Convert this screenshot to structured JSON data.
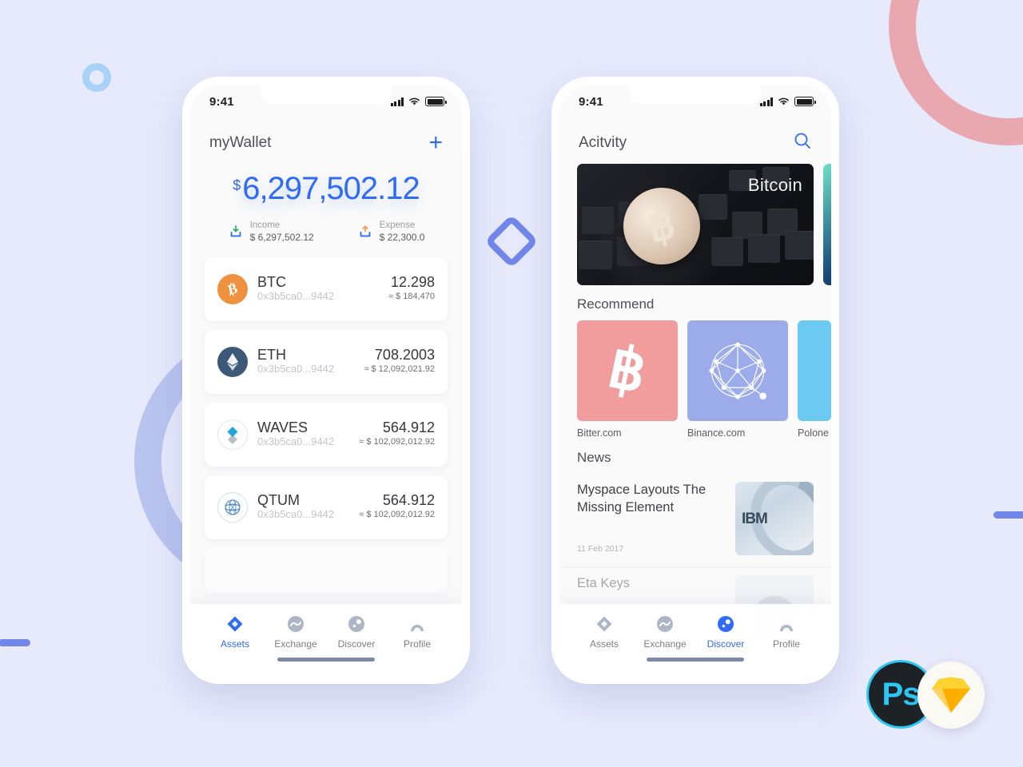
{
  "canvas": {
    "background": "#e7eafb",
    "accent": "#2f6bf5",
    "peri": "#7387ea",
    "pink": "#e9a7b0"
  },
  "badges": {
    "photoshop_label": "Ps",
    "sketch_label": "sketch-diamond-icon"
  },
  "phone1": {
    "status": {
      "time": "9:41",
      "signal": "signal-icon",
      "wifi": "wifi-icon",
      "battery": "battery-icon"
    },
    "header": {
      "title": "myWallet",
      "add_label": "+"
    },
    "balance": {
      "currency_symbol": "$",
      "amount": "6,297,502.12"
    },
    "summary": [
      {
        "label": "Income",
        "value": "$ 6,297,502.12",
        "icon": "income-icon"
      },
      {
        "label": "Expense",
        "value": "$ 22,300.0",
        "icon": "expense-icon"
      }
    ],
    "coins": [
      {
        "name": "BTC",
        "address": "0x3b5ca0...9442",
        "amount": "12.298",
        "usd": "≈ $ 184,470",
        "icon": "btc-icon"
      },
      {
        "name": "ETH",
        "address": "0x3b5ca0...9442",
        "amount": "708.2003",
        "usd": "≈ $ 12,092,021.92",
        "icon": "eth-icon"
      },
      {
        "name": "WAVES",
        "address": "0x3b5ca0...9442",
        "amount": "564.912",
        "usd": "≈ $ 102,092,012.92",
        "icon": "waves-icon"
      },
      {
        "name": "QTUM",
        "address": "0x3b5ca0...9442",
        "amount": "564.912",
        "usd": "≈ $ 102,092,012.92",
        "icon": "qtum-icon"
      }
    ],
    "tabs": [
      {
        "label": "Assets",
        "icon": "assets-icon",
        "active": true
      },
      {
        "label": "Exchange",
        "icon": "exchange-icon",
        "active": false
      },
      {
        "label": "Discover",
        "icon": "discover-icon",
        "active": false
      },
      {
        "label": "Profile",
        "icon": "profile-icon",
        "active": false
      }
    ]
  },
  "phone2": {
    "status": {
      "time": "9:41",
      "signal": "signal-icon",
      "wifi": "wifi-icon",
      "battery": "battery-icon"
    },
    "header": {
      "title": "Acitvity",
      "search_icon": "search-icon"
    },
    "banner": {
      "label": "Bitcoin",
      "alt": "bitcoin-coin-on-keyboard"
    },
    "recommend": {
      "title": "Recommend",
      "items": [
        {
          "name": "Bitter.com",
          "color": "#f29d9d",
          "icon": "bitcoin-b-icon"
        },
        {
          "name": "Binance.com",
          "color": "#9cacea",
          "icon": "polygon-network-icon"
        },
        {
          "name": "Polone",
          "color": "#6cc9f2",
          "icon": "poloniex-icon"
        }
      ]
    },
    "news": {
      "title": "News",
      "items": [
        {
          "title": "Myspace Layouts The Missing Element",
          "date": "11 Feb 2017",
          "thumb": "ibm-server-thumb"
        },
        {
          "title": "Eta Keys",
          "date": "",
          "thumb": "avatar-thumb"
        }
      ]
    },
    "tabs": [
      {
        "label": "Assets",
        "icon": "assets-icon",
        "active": false
      },
      {
        "label": "Exchange",
        "icon": "exchange-icon",
        "active": false
      },
      {
        "label": "Discover",
        "icon": "discover-icon",
        "active": true
      },
      {
        "label": "Profile",
        "icon": "profile-icon",
        "active": false
      }
    ]
  }
}
